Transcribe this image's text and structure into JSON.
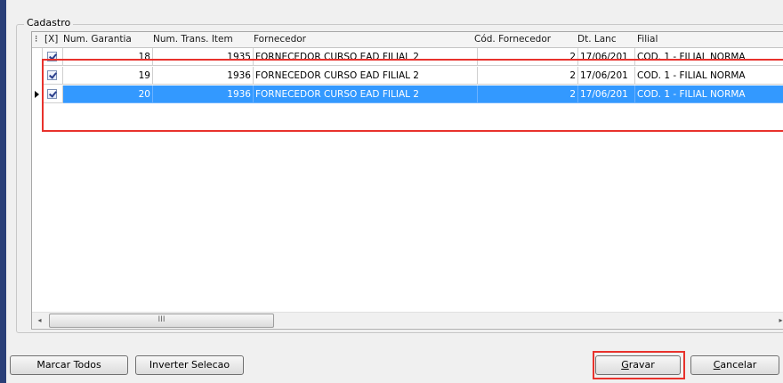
{
  "group_title": "Cadastro",
  "columns": [
    "⁝",
    "[X]",
    "Num. Garantia",
    "Num. Trans. Item",
    "Fornecedor",
    "Cód. Fornecedor",
    "Dt. Lanc",
    "Filial"
  ],
  "rows": [
    {
      "checked": true,
      "num_garantia": "18",
      "num_trans_item": "1935",
      "fornecedor": "FORNECEDOR CURSO EAD FILIAL 2",
      "cod_fornecedor": "2",
      "dt_lanc": "17/06/201",
      "filial": "COD. 1 - FILIAL NORMA"
    },
    {
      "checked": true,
      "num_garantia": "19",
      "num_trans_item": "1936",
      "fornecedor": "FORNECEDOR CURSO EAD FILIAL 2",
      "cod_fornecedor": "2",
      "dt_lanc": "17/06/201",
      "filial": "COD. 1 - FILIAL NORMA"
    },
    {
      "checked": true,
      "num_garantia": "20",
      "num_trans_item": "1936",
      "fornecedor": "FORNECEDOR CURSO EAD FILIAL 2",
      "cod_fornecedor": "2",
      "dt_lanc": "17/06/201",
      "filial": "COD. 1 - FILIAL NORMA",
      "selected": true
    }
  ],
  "scrollbar": {
    "left_arrow": "◂",
    "right_arrow": "▸",
    "grip": "III"
  },
  "buttons": {
    "marcar_todos": "Marcar Todos",
    "inverter_selecao": "Inverter Selecao",
    "gravar_first": "G",
    "gravar_rest": "ravar",
    "cancelar_first": "C",
    "cancelar_rest": "ancelar"
  },
  "colors": {
    "selection": "#3399ff",
    "highlight": "#e8322c"
  }
}
